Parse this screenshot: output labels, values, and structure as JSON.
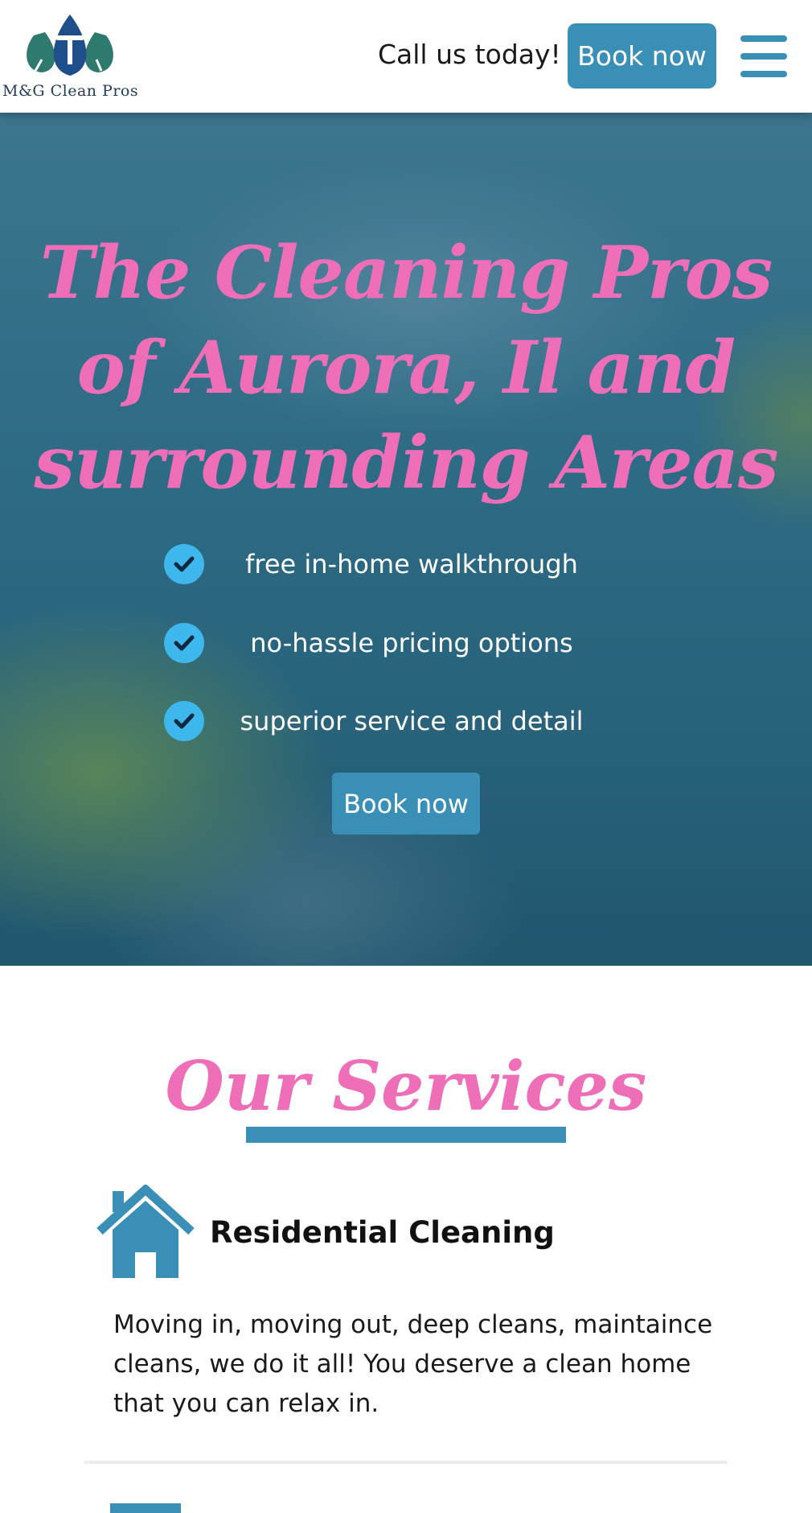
{
  "header": {
    "logo_text": "M&G Clean Pros",
    "call_text": "Call us today!",
    "book_label": "Book now",
    "menu_icon": "hamburger-menu-icon"
  },
  "hero": {
    "title": "The Cleaning Pros of Aurora, Il and surrounding Areas",
    "features": [
      "free in-home walkthrough",
      "no-hassle pricing options",
      "superior service and detail"
    ],
    "feature_icon": "checkmark-circle-icon",
    "book_label": "Book now"
  },
  "services": {
    "title": "Our Services",
    "items": [
      {
        "icon": "house-icon",
        "name": "Residential Cleaning",
        "description": "Moving in, moving out, deep cleans, maintaince cleans, we do it all! You deserve a clean home that you can relax in."
      }
    ]
  },
  "colors": {
    "accent_blue": "#3a8fb7",
    "accent_pink": "#ef6eb8",
    "check_blue": "#3db7ec"
  }
}
